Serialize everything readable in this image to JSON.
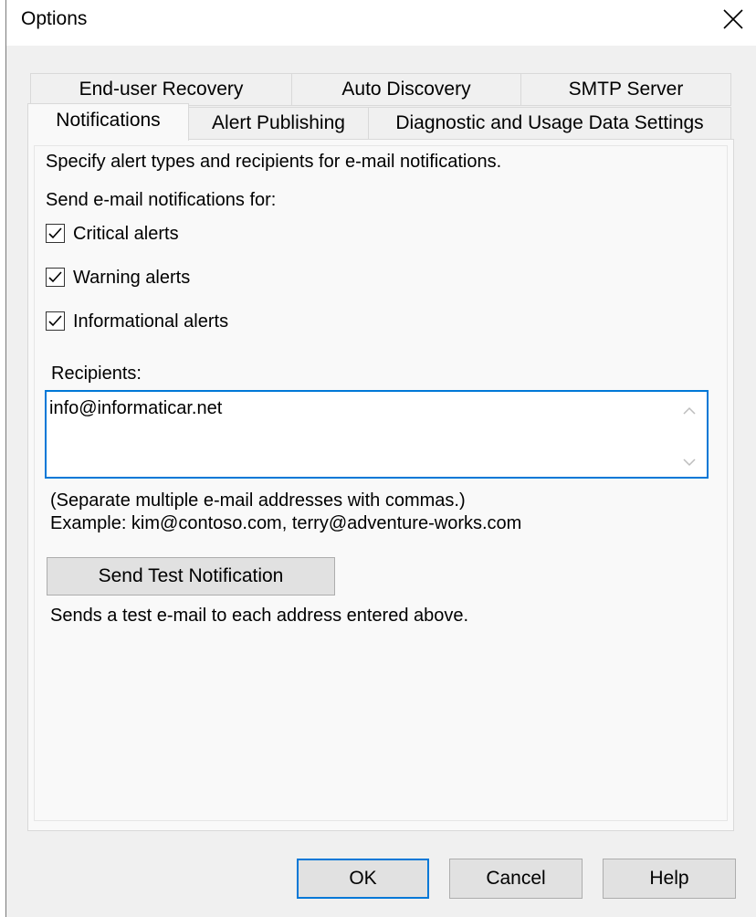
{
  "window": {
    "title": "Options",
    "close_icon": "close-icon"
  },
  "tabs_row1": [
    "End-user Recovery",
    "Auto Discovery",
    "SMTP Server"
  ],
  "tabs_row2": [
    "Notifications",
    "Alert Publishing",
    "Diagnostic and Usage Data Settings"
  ],
  "active_tab": "Notifications",
  "notifications": {
    "description": "Specify alert types and recipients for e-mail notifications.",
    "send_for_label": "Send e-mail notifications for:",
    "checkboxes": [
      {
        "label": "Critical alerts",
        "checked": true
      },
      {
        "label": "Warning alerts",
        "checked": true
      },
      {
        "label": "Informational alerts",
        "checked": true
      }
    ],
    "recipients_label": "Recipients:",
    "recipients_value": "info@informaticar.net",
    "hint_line1": "(Separate multiple e-mail addresses with commas.)",
    "hint_line2": "Example: kim@contoso.com, terry@adventure-works.com",
    "send_test_button": "Send Test Notification",
    "send_test_desc": "Sends a test e-mail to each address entered above."
  },
  "footer": {
    "ok": "OK",
    "cancel": "Cancel",
    "help": "Help"
  },
  "colors": {
    "accent": "#0078d7",
    "background": "#f0f0f0",
    "panel": "#f9f9f9"
  }
}
